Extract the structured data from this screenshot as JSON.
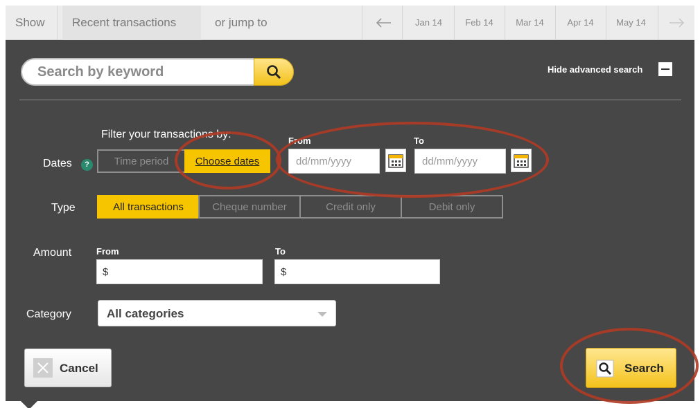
{
  "topbar": {
    "show_label": "Show",
    "recent_label": "Recent transactions",
    "jump_label": "or jump to",
    "months": [
      "Jan 14",
      "Feb 14",
      "Mar 14",
      "Apr 14",
      "May 14"
    ]
  },
  "search": {
    "placeholder": "Search by keyword",
    "hide_advanced_label": "Hide advanced search"
  },
  "filters": {
    "intro": "Filter your transactions by:",
    "dates_label": "Dates",
    "dates_options": [
      "Time period",
      "Choose dates"
    ],
    "from_label": "From",
    "to_label": "To",
    "date_placeholder": "dd/mm/yyyy",
    "type_label": "Type",
    "type_options": [
      "All transactions",
      "Cheque number",
      "Credit only",
      "Debit only"
    ],
    "amount_label": "Amount",
    "amount_from_label": "From",
    "amount_to_label": "To",
    "currency_symbol": "$",
    "category_label": "Category",
    "category_value": "All categories"
  },
  "actions": {
    "cancel_label": "Cancel",
    "search_label": "Search"
  },
  "colors": {
    "panel": "#474747",
    "accent": "#f7c400",
    "annotation": "#b03a25"
  }
}
